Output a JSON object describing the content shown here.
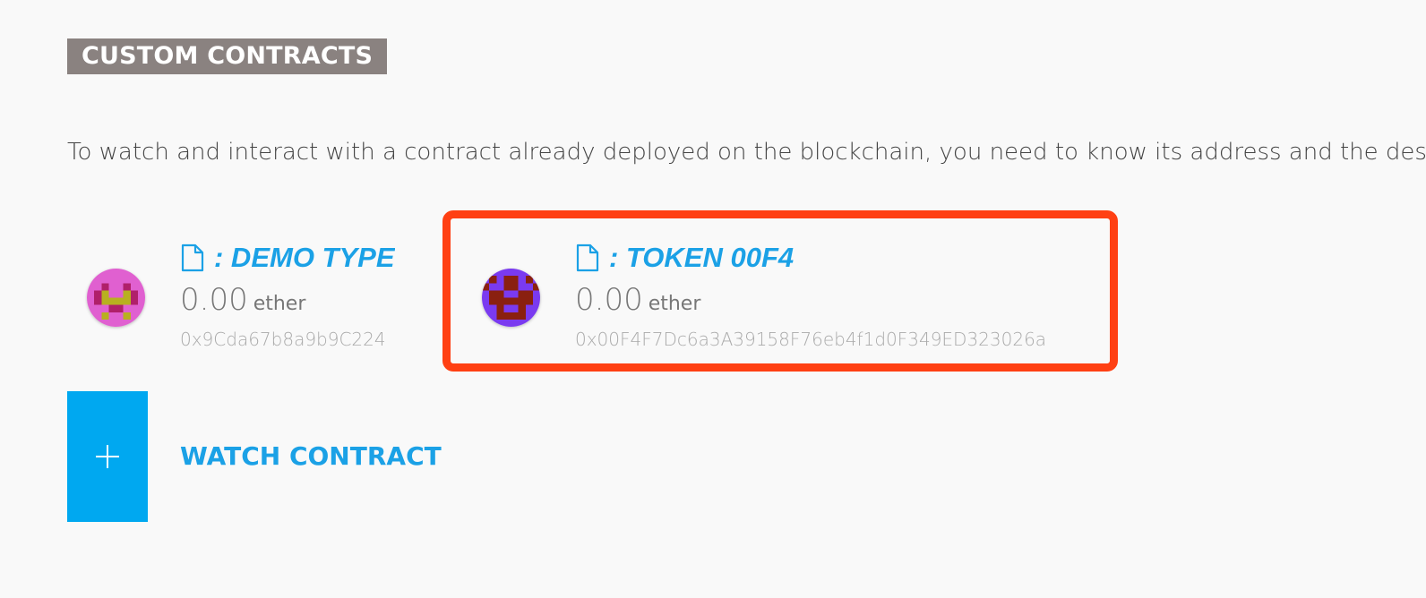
{
  "section": {
    "title": "CUSTOM CONTRACTS",
    "intro": "To watch and interact with a contract already deployed on the blockchain, you need to know its address and the descrip"
  },
  "contracts": [
    {
      "name": ": DEMO TYPE",
      "balance": "0.00",
      "unit": "ether",
      "address": "0x9Cda67b8a9b9C224",
      "identicon": "pink-yellow-identicon"
    },
    {
      "name": ": TOKEN 00F4",
      "balance": "0.00",
      "unit": "ether",
      "address": "0x00F4F7Dc6a3A39158F76eb4f1d0F349ED323026a",
      "identicon": "purple-red-identicon",
      "highlighted": true
    }
  ],
  "watch": {
    "label": "WATCH CONTRACT",
    "icon": "plus-icon"
  },
  "colors": {
    "accent": "#1ba1e6",
    "button": "#00a8f0",
    "title_bg": "#8a8280",
    "highlight": "#ff4013"
  }
}
